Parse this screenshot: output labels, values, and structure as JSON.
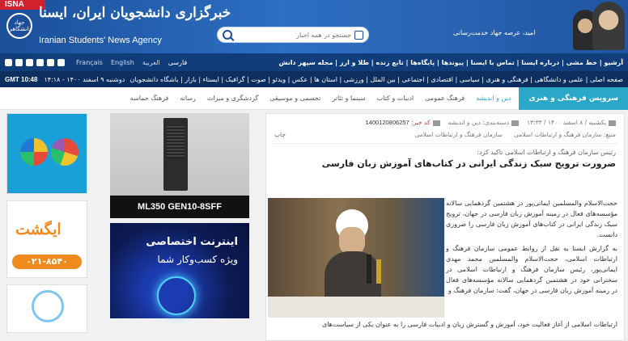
{
  "header": {
    "badge": "ISNA",
    "emblem_text": "جهاد دانشگاهی",
    "logo_fa": "خبرگزاری دانشجویان ایران، ایسنا",
    "logo_en": "Iranian Students' News Agency",
    "search_placeholder": "جستجو در همه اخبار",
    "quote": "امید، عرصه جهاد خدمت‌رسانی"
  },
  "topnav": {
    "languages": [
      "فارسی",
      "العربية",
      "English",
      "Français"
    ],
    "links": "آرشیو | خط مشی | درباره ایسنا | تماس با ایسنا | پیوندها | پایگاه‌ها | تابع زنده | طلا و ارز | مجله سپهر دانش"
  },
  "subnav": {
    "time": "GMT 10:48",
    "date": "دوشنبه ۹ اسفند ۱۴۰۰ - ۱۴:۱۸",
    "categories": "صفحه اصلی | علمی و دانشگاهی | فرهنگی و هنری | سیاسی | اقتصادی | اجتماعی | بین الملل | ورزشی | استان ها | عکس | ویدئو | صوت | گرافیک | ایستاء | بازار | باشگاه دانشجویان"
  },
  "service": {
    "label": "سرویس فرهنگی و هنری",
    "items": [
      "دین و اندیشه",
      "فرهنگ عمومی",
      "ادبیات و کتاب",
      "سینما و تئاتر",
      "تجسمی و موسیقی",
      "گردشگری و میراث",
      "رسانه",
      "فرهنگ حماسه"
    ]
  },
  "ads": {
    "left2_brand": "ایگشت",
    "left2_phone": "۰۲۱-۸۵۴۰",
    "server_label": "ML350 GEN10-8SFF",
    "inet_line1": "اینترنت اختصاصی",
    "inet_line2": "ویژه کسب‌وکار شما"
  },
  "article": {
    "date": "یکشنبه / ۸ اسفند ۱۴۰۰ / ۱۳:۳۳",
    "category": "دسته‌بندی: دین و اندیشه",
    "code_label": "کد خبر:",
    "code": "1400120806257",
    "source": "منبع: سازمان فرهنگ و ارتباطات اسلامی",
    "source2": "سازمان فرهنگ و ارتباطات اسلامی",
    "print": "چاپ",
    "lead": "رئیس سازمان فرهنگ و ارتباطات اسلامی تاکید کرد:",
    "title": "ضرورت ترویج سبک زندگی ایرانی در کتاب‌های آموزش زبان فارسی",
    "para1": "حجت‌الاسلام والمسلمین ایمانی‌پور در هشتمین گردهمایی سالانه مؤسسه‌های فعال در زمینه آموزش زبان فارسی در جهان، ترویج سبک زندگی ایرانی در کتاب‌های آموزش زبان فارسی را ضروری دانست.",
    "para2": "به گزارش ایسنا به نقل از روابط عمومی سازمان فرهنگ و ارتباطات اسلامی، حجت‌الاسلام والمسلمین محمد مهدی ایمانی‌پور، رئیس سازمان فرهنگ و ارتباطات اسلامی در سخنرانی خود در هشتمین گردهمایی سالانه مؤسسه‌های فعال در زمینه آموزش زبان فارسی در جهان، گفت: سازمان فرهنگ و",
    "para3": "ارتباطات اسلامی از آغاز فعالیت خود، آموزش و گسترش زبان و ادبیات فارسی را به عنوان یکی از سیاست‌های"
  }
}
